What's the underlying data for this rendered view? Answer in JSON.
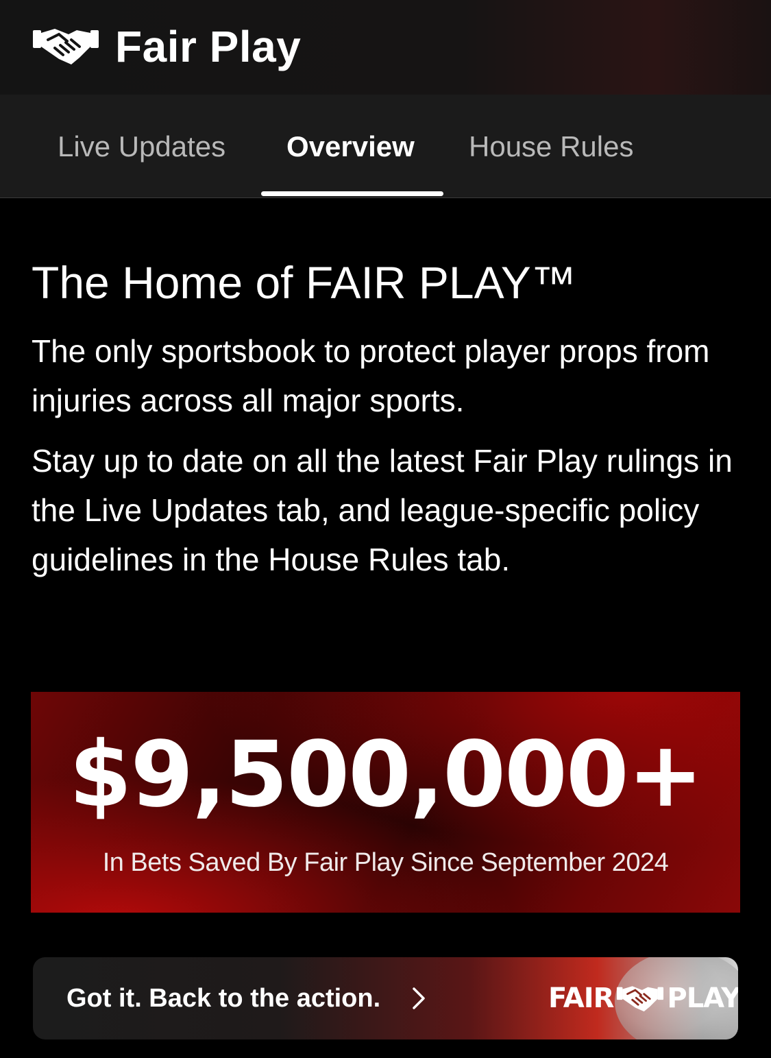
{
  "header": {
    "logo_icon": "handshake-icon",
    "title": "Fair Play"
  },
  "tabs": [
    {
      "label": "Live Updates",
      "active": false
    },
    {
      "label": "Overview",
      "active": true
    },
    {
      "label": "House Rules",
      "active": false
    }
  ],
  "overview": {
    "title": "The Home of FAIR PLAY™",
    "paragraph_1": "The only sportsbook to protect player props from injuries across all major sports.",
    "paragraph_2": "Stay up to date on all the latest Fair Play rulings in the Live Updates tab, and league-specific policy guidelines in the House Rules tab."
  },
  "banner": {
    "amount": "$9,500,000+",
    "caption": "In Bets Saved By Fair Play Since September 2024"
  },
  "cta": {
    "label": "Got it. Back to the action.",
    "chevron_icon": "chevron-right-icon",
    "brand_left": "FAIR",
    "brand_icon": "handshake-icon",
    "brand_right": "PLAY"
  },
  "colors": {
    "background": "#000000",
    "header_bg": "#141414",
    "tabs_bg": "#1b1b1b",
    "tab_inactive": "#b9b9b9",
    "accent_red": "#b50a0a"
  }
}
